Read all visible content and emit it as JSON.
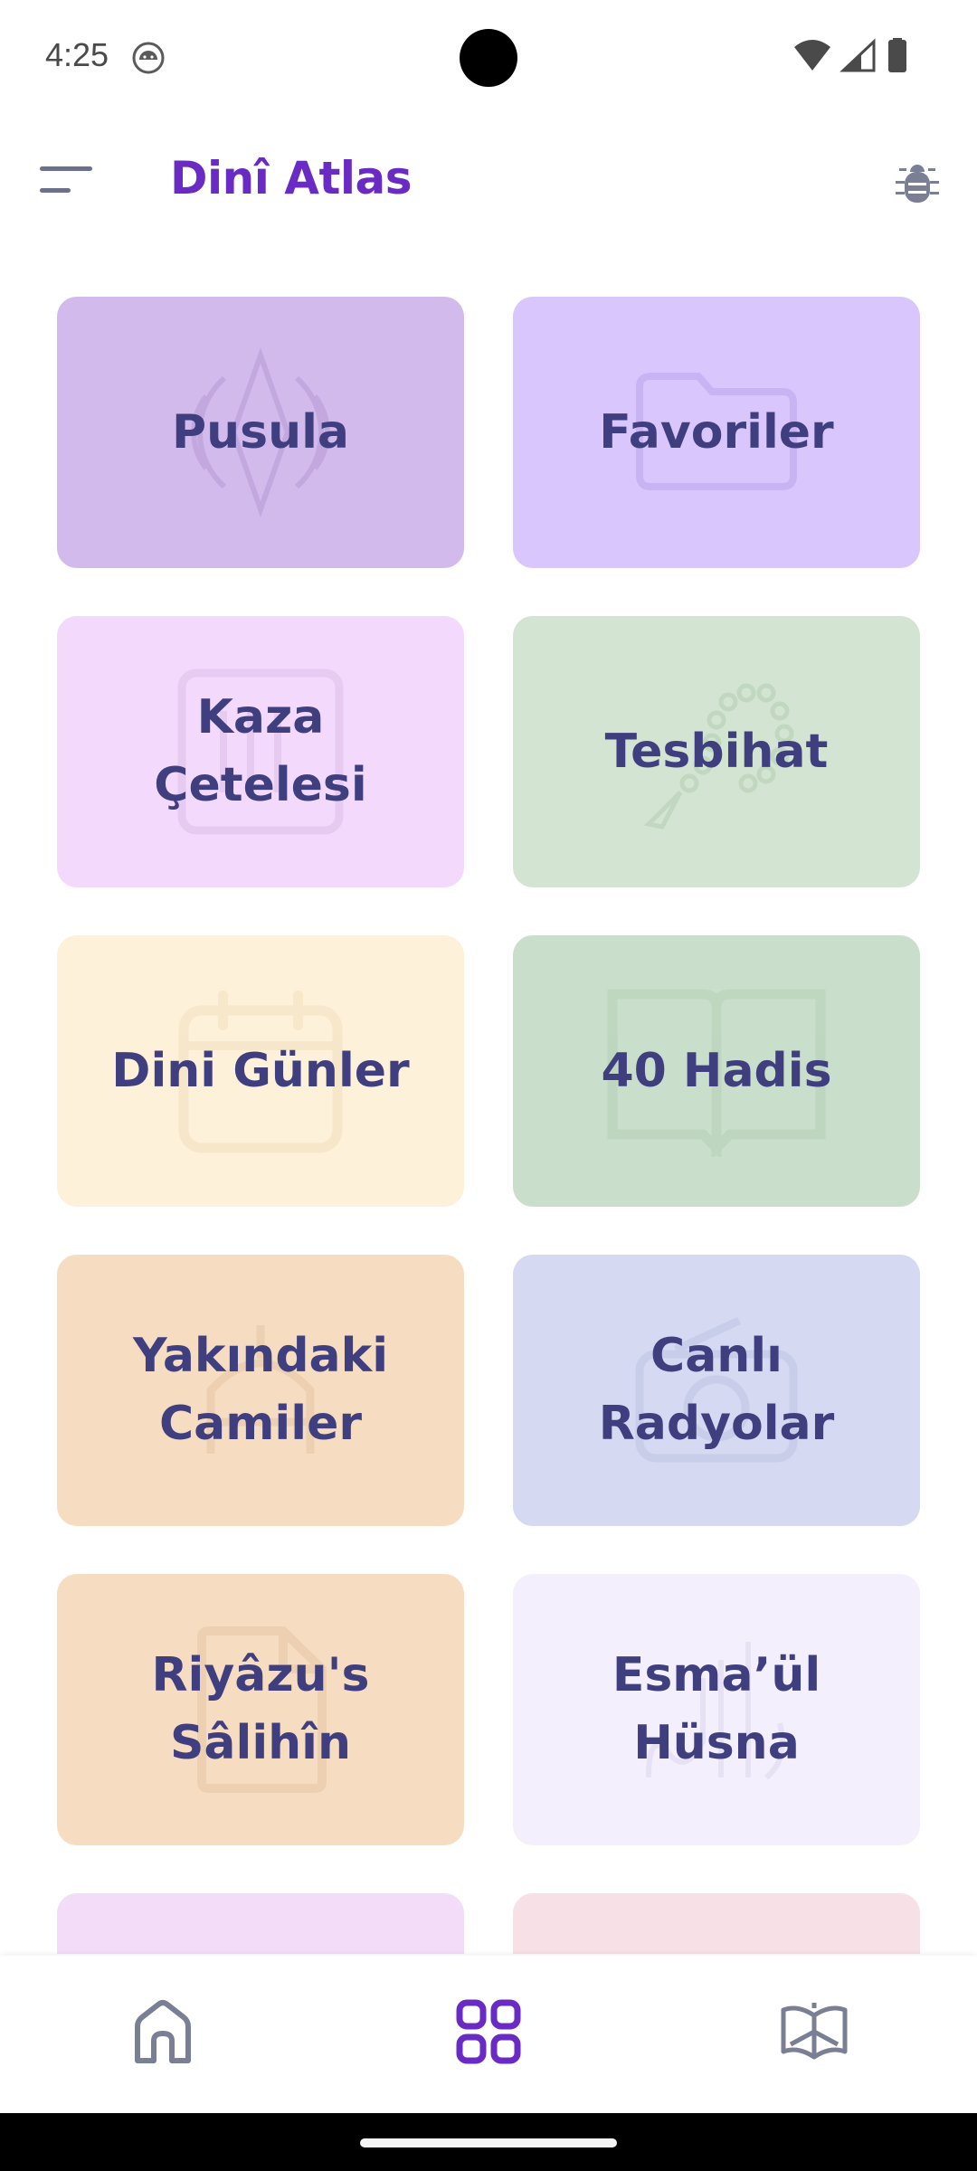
{
  "status_bar": {
    "time": "4:25"
  },
  "app_bar": {
    "title": "Dinî Atlas"
  },
  "grid": {
    "cards": [
      {
        "label": "Pusula",
        "color": "#d3baec",
        "icon": "compass-icon"
      },
      {
        "label": "Favoriler",
        "color": "#d9c6fc",
        "icon": "folder-icon"
      },
      {
        "label": "Kaza\nÇetelesi",
        "color": "#f3d9fb",
        "icon": "tally-icon"
      },
      {
        "label": "Tesbihat",
        "color": "#d3e5d2",
        "icon": "prayer-beads-icon"
      },
      {
        "label": "Dini Günler",
        "color": "#fef1da",
        "icon": "calendar-icon"
      },
      {
        "label": "40 Hadis",
        "color": "#cadfcb",
        "icon": "open-book-icon"
      },
      {
        "label": "Yakındaki\nCamiler",
        "color": "#f6ddc1",
        "icon": "mosque-icon"
      },
      {
        "label": "Canlı\nRadyolar",
        "color": "#d5d9f2",
        "icon": "radio-icon"
      },
      {
        "label": "Riyâzu's\nSâlihîn",
        "color": "#f6ddc1",
        "icon": "document-icon"
      },
      {
        "label": "Esma’ül\nHüsna",
        "color": "#f3effc",
        "icon": "calligraphy-icon"
      },
      {
        "label": "",
        "color": "#f2dcf8",
        "icon": ""
      },
      {
        "label": "",
        "color": "#f7e0e6",
        "icon": ""
      }
    ]
  },
  "bottom_nav": {
    "items": [
      {
        "icon": "home-icon",
        "active": false
      },
      {
        "icon": "grid-icon",
        "active": true
      },
      {
        "icon": "quran-book-icon",
        "active": false
      }
    ],
    "active_color": "#6a2bc4",
    "inactive_color": "#7a7f96"
  }
}
